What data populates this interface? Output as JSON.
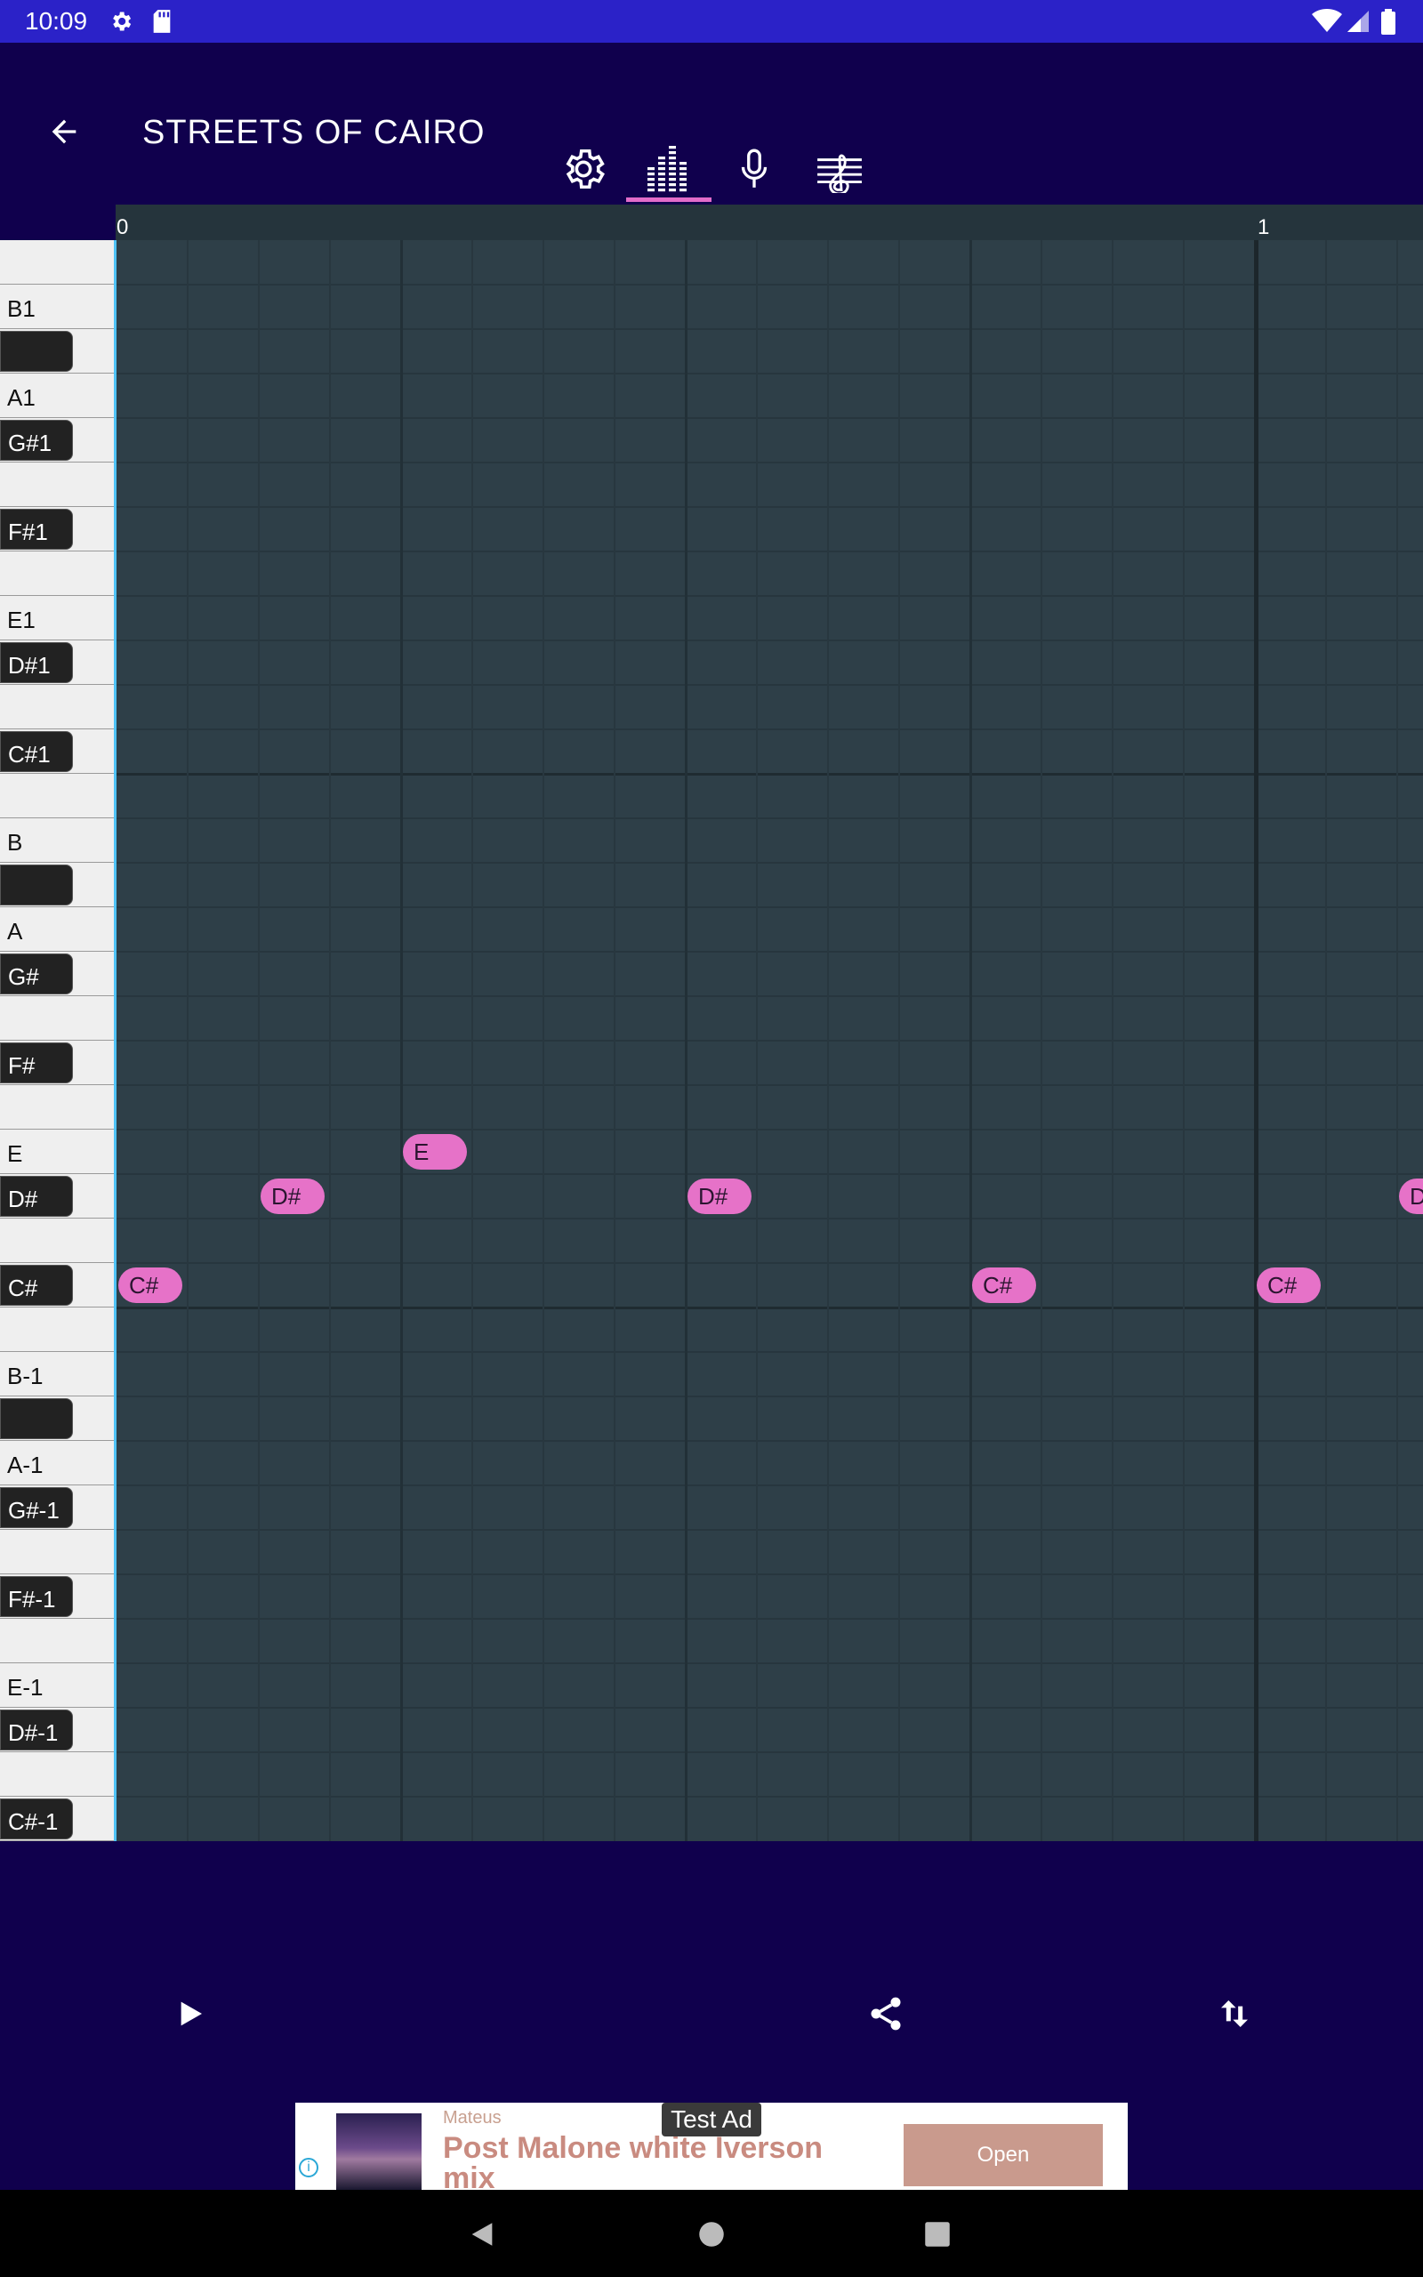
{
  "status_bar": {
    "time": "10:09",
    "icons": [
      "gear-icon",
      "sd-card-icon",
      "wifi-icon",
      "signal-icon",
      "battery-icon"
    ]
  },
  "app_bar": {
    "title": "STREETS OF CAIRO",
    "back_icon": "arrow-back-icon",
    "tabs": [
      {
        "name": "settings",
        "icon": "gear-icon",
        "selected": false
      },
      {
        "name": "piano-roll",
        "icon": "equalizer-bars-icon",
        "selected": true
      },
      {
        "name": "record",
        "icon": "microphone-icon",
        "selected": false
      },
      {
        "name": "sheet-music",
        "icon": "treble-clef-icon",
        "selected": false
      }
    ]
  },
  "ruler": {
    "marks": [
      "0",
      "1"
    ]
  },
  "piano_keys": [
    {
      "label": "",
      "black": false
    },
    {
      "label": "B1",
      "black": false
    },
    {
      "label": "",
      "black": true
    },
    {
      "label": "A1",
      "black": false
    },
    {
      "label": "G#1",
      "black": true
    },
    {
      "label": "",
      "black": false
    },
    {
      "label": "F#1",
      "black": true
    },
    {
      "label": "",
      "black": false
    },
    {
      "label": "E1",
      "black": false
    },
    {
      "label": "D#1",
      "black": true
    },
    {
      "label": "",
      "black": false
    },
    {
      "label": "C#1",
      "black": true
    },
    {
      "label": "",
      "black": false
    },
    {
      "label": "B",
      "black": false
    },
    {
      "label": "",
      "black": true
    },
    {
      "label": "A",
      "black": false
    },
    {
      "label": "G#",
      "black": true
    },
    {
      "label": "",
      "black": false
    },
    {
      "label": "F#",
      "black": true
    },
    {
      "label": "",
      "black": false
    },
    {
      "label": "E",
      "black": false
    },
    {
      "label": "D#",
      "black": true
    },
    {
      "label": "",
      "black": false
    },
    {
      "label": "C#",
      "black": true
    },
    {
      "label": "",
      "black": false
    },
    {
      "label": "B-1",
      "black": false
    },
    {
      "label": "",
      "black": true
    },
    {
      "label": "A-1",
      "black": false
    },
    {
      "label": "G#-1",
      "black": true
    },
    {
      "label": "",
      "black": false
    },
    {
      "label": "F#-1",
      "black": true
    },
    {
      "label": "",
      "black": false
    },
    {
      "label": "E-1",
      "black": false
    },
    {
      "label": "D#-1",
      "black": true
    },
    {
      "label": "",
      "black": false
    },
    {
      "label": "C#-1",
      "black": true
    }
  ],
  "notes": [
    {
      "label": "C#",
      "row": 23,
      "step": 0
    },
    {
      "label": "D#",
      "row": 21,
      "step": 2
    },
    {
      "label": "E",
      "row": 20,
      "step": 4
    },
    {
      "label": "D#",
      "row": 21,
      "step": 8
    },
    {
      "label": "C#",
      "row": 23,
      "step": 12
    },
    {
      "label": "C#",
      "row": 23,
      "step": 16
    },
    {
      "label": "D",
      "row": 21,
      "step": 18
    }
  ],
  "controls": {
    "play_icon": "play-icon",
    "share_icon": "share-icon",
    "swap_icon": "swap-vertical-icon"
  },
  "ad": {
    "badge": "Test Ad",
    "advertiser": "Mateus",
    "headline": "Post Malone white Iverson mix",
    "cta": "Open"
  },
  "nav_bar": {
    "icons": [
      "back-triangle-icon",
      "home-circle-icon",
      "recents-square-icon"
    ]
  },
  "colors": {
    "background": "#10004d",
    "status_bar": "#2b22c8",
    "accent": "#e26cc9",
    "note": "#e672c8",
    "grid": "#2e3f48"
  }
}
